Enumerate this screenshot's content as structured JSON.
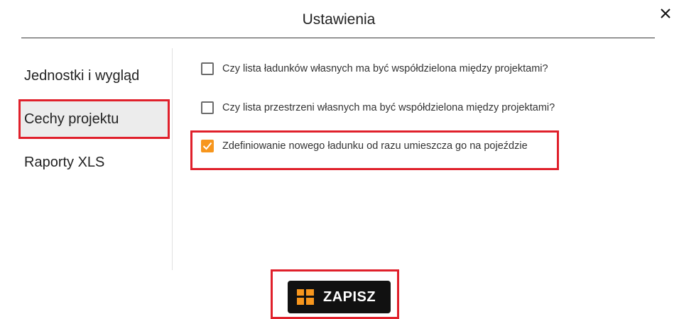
{
  "dialog": {
    "title": "Ustawienia",
    "close_icon": "close-icon"
  },
  "sidebar": {
    "items": [
      {
        "label": "Jednostki i wygląd",
        "selected": false
      },
      {
        "label": "Cechy projektu",
        "selected": true
      },
      {
        "label": "Raporty XLS",
        "selected": false
      }
    ]
  },
  "options": [
    {
      "label": "Czy lista ładunków własnych ma być współdzielona między projektami?",
      "checked": false
    },
    {
      "label": "Czy lista przestrzeni własnych ma być współdzielona między projektami?",
      "checked": false
    },
    {
      "label": "Zdefiniowanie nowego ładunku od razu umieszcza go na pojeździe",
      "checked": true
    }
  ],
  "save_button": {
    "label": "ZAPISZ",
    "icon": "grid-icon"
  },
  "colors": {
    "accent": "#f7961d",
    "highlight": "#e0202b",
    "button_bg": "#111111"
  }
}
